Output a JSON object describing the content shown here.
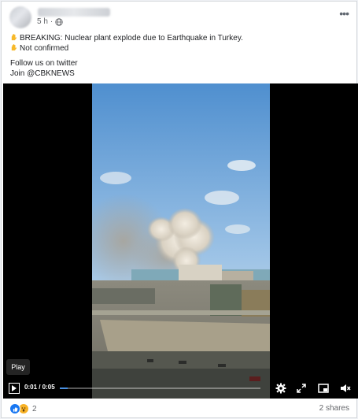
{
  "post": {
    "timestamp": "5 h",
    "lines": [
      "BREAKING: Nuclear plant explode due to Earthquake in Turkey.",
      "Not confirmed"
    ],
    "follow": "Follow us on  twitter",
    "join": "Join @CBKNEWS"
  },
  "video": {
    "play_tooltip": "Play",
    "time": "0:01 / 0:05",
    "progress": 0.04,
    "accent": "#4a90e2"
  },
  "footer": {
    "reaction_count": "2",
    "shares": "2 shares"
  },
  "icons": [
    "globe-icon",
    "more-options-icon",
    "raising-hand-emoji",
    "play-icon",
    "settings-icon",
    "expand-icon",
    "miniplayer-icon",
    "mute-icon",
    "like-icon",
    "wow-icon"
  ]
}
